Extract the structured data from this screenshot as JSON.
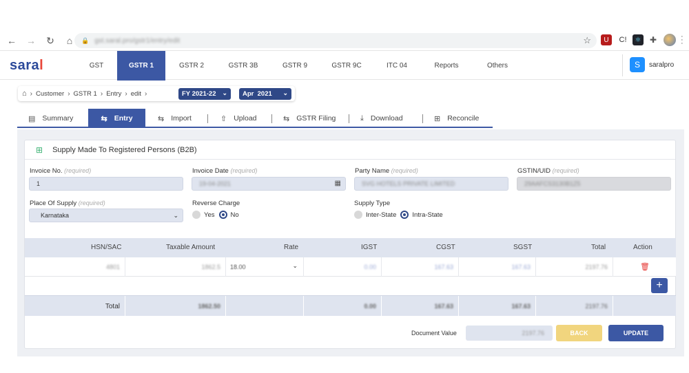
{
  "browser": {
    "url": "gst.saral.pro/gstr1/entry/edit"
  },
  "app": {
    "logo_main": "sara",
    "logo_accent": "l",
    "user_initial": "S",
    "user_name": "saralpro"
  },
  "topnav": [
    "GST",
    "GSTR 1",
    "GSTR 2",
    "GSTR 3B",
    "GSTR 9",
    "GSTR 9C",
    "ITC 04",
    "Reports",
    "Others"
  ],
  "breadcrumb": {
    "items": [
      "Customer",
      "GSTR 1",
      "Entry",
      "edit"
    ],
    "fy": "FY 2021-22",
    "month": "Apr  2021"
  },
  "subtabs": [
    "Summary",
    "Entry",
    "Import",
    "Upload",
    "GSTR Filing",
    "Download",
    "Reconcile"
  ],
  "form": {
    "title": "Supply Made To Registered Persons (B2B)",
    "required": "(required)",
    "invoice_no_label": "Invoice No.",
    "invoice_no_value": "1",
    "invoice_date_label": "Invoice Date",
    "invoice_date_value": "19-04-2021",
    "party_name_label": "Party Name",
    "party_name_value": "SVG HOTELS PRIVATE LIMITED",
    "gstin_label": "GSTIN/UID",
    "gstin_value": "29AAFCS3130B1Z5",
    "pos_label": "Place Of Supply",
    "pos_value": "Karnataka",
    "reverse_charge_label": "Reverse Charge",
    "rc_yes": "Yes",
    "rc_no": "No",
    "supply_type_label": "Supply Type",
    "st_inter": "Inter-State",
    "st_intra": "Intra-State"
  },
  "table": {
    "headers": [
      "HSN/SAC",
      "Taxable Amount",
      "Rate",
      "IGST",
      "CGST",
      "SGST",
      "Total",
      "Action"
    ],
    "row": {
      "hsn": "4801",
      "taxable": "1862.5",
      "rate": "18.00",
      "igst": "0.00",
      "cgst": "167.63",
      "sgst": "167.63",
      "total": "2197.76"
    },
    "footer": {
      "label": "Total",
      "taxable": "1862.50",
      "igst": "0.00",
      "cgst": "167.63",
      "sgst": "167.63",
      "total": "2197.76"
    }
  },
  "footer": {
    "doc_value_label": "Document Value",
    "doc_value": "2197.76",
    "back_label": "BACK",
    "update_label": "UPDATE"
  },
  "colors": {
    "primary": "#3c58a4",
    "back_button": "#f1d57e",
    "delete_icon": "#e53935",
    "accent_green": "#3bb273"
  }
}
